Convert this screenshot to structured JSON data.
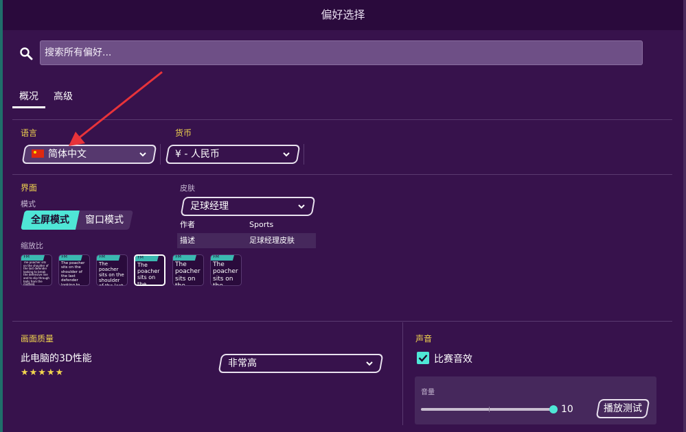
{
  "window": {
    "title": "偏好选择"
  },
  "search": {
    "placeholder": "搜索所有偏好..."
  },
  "tabs": [
    {
      "label": "概况",
      "active": true
    },
    {
      "label": "高级",
      "active": false
    }
  ],
  "language": {
    "label": "语言",
    "value": "简体中文"
  },
  "currency": {
    "label": "货币",
    "value": "¥ - 人民币"
  },
  "interface": {
    "title": "界面",
    "mode_label": "模式",
    "modes": [
      {
        "label": "全屏模式",
        "active": true
      },
      {
        "label": "窗口模式",
        "active": false
      }
    ],
    "scale_label": "缩放比",
    "scale_options": [
      {
        "header": "FM",
        "text": "The poacher sits on the shoulder of the last defender looking to break the defensive line and to slip through balls from the midfield."
      },
      {
        "header": "FM",
        "text": "The poacher sits on the shoulder of the last defender looking to break the defensive line and to run through balls fr"
      },
      {
        "header": "FM",
        "text": "The poacher sits on the shoulder of the last defender looking to break the defensive line"
      },
      {
        "header": "FM",
        "text": "The poacher sits on the shoulder of the last defender looking to break the"
      },
      {
        "header": "FM",
        "text": "The poacher sits on the shoulder of the last defender"
      },
      {
        "header": "FM",
        "text": "The poacher sits on the shoulder of the last defender"
      }
    ],
    "selected_scale_index": 3
  },
  "skin": {
    "label": "皮肤",
    "value": "足球经理",
    "author_label": "作者",
    "author": "Sports Interactive",
    "description_label": "描述",
    "description": "足球经理皮肤"
  },
  "graphics": {
    "title": "画面质量",
    "label": "此电脑的3D性能",
    "stars": "★★★★★",
    "value": "非常高"
  },
  "sound": {
    "title": "声音",
    "match_sfx_label": "比赛音效",
    "match_sfx_checked": true,
    "volume_label": "音量",
    "volume_value": "10",
    "test_button": "播放测试"
  },
  "colors": {
    "accent": "#4fe6d6",
    "section_title": "#f2d54e",
    "background": "#37124c",
    "annotation_arrow": "#e8333a"
  }
}
